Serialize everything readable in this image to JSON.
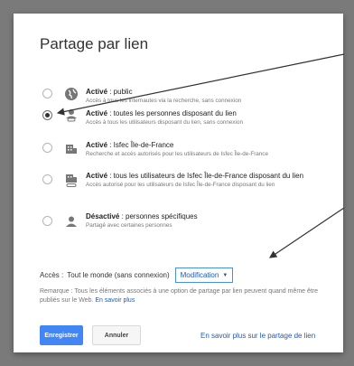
{
  "dialog": {
    "title": "Partage par lien",
    "options": [
      {
        "bold": "Activé",
        "rest": " : public",
        "desc": "Accès à tous les internautes via la recherche, sans connexion",
        "checked": false,
        "icon": "globe-icon"
      },
      {
        "bold": "Activé",
        "rest": " : toutes les personnes disposant du lien",
        "desc": "Accès à tous les utilisateurs disposant du lien, sans connexion",
        "checked": true,
        "icon": "link-user-icon"
      },
      {
        "bold": "Activé",
        "rest": " : Isfec Île-de-France",
        "desc": "Recherche et accès autorisés pour les utilisateurs de Isfec Île-de-France",
        "checked": false,
        "icon": "building-icon"
      },
      {
        "bold": "Activé",
        "rest": " : tous les utilisateurs de Isfec Île-de-France disposant du lien",
        "desc": "Accès autorisé pour les utilisateurs de Isfec Île-de-France disposant du lien",
        "checked": false,
        "icon": "building-link-icon"
      },
      {
        "bold": "Désactivé",
        "rest": " : personnes spécifiques",
        "desc": "Partagé avec certaines personnes",
        "checked": false,
        "icon": "person-icon"
      }
    ],
    "access_label": "Accès :",
    "access_value": "Tout le monde (sans connexion)",
    "access_mode": "Modification",
    "remark": "Remarque : Tous les éléments associés à une option de partage par lien peuvent quand même être publiés sur le Web. ",
    "remark_link": "En savoir plus",
    "save_label": "Enregistrer",
    "cancel_label": "Annuler",
    "learn_link": "En savoir plus sur le partage de lien"
  },
  "colors": {
    "accent": "#4285f4",
    "link": "#1a5bb8",
    "backdrop": "#7a7a7a"
  }
}
